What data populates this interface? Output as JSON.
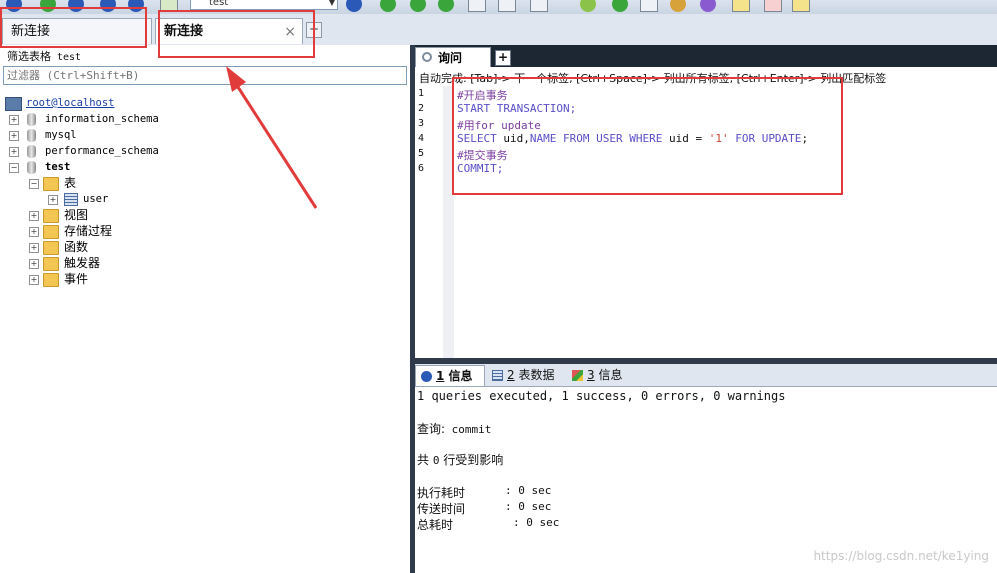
{
  "toolbar": {
    "database_select": "test",
    "colors": {
      "green": "#3aa53a",
      "blue": "#2b59b8"
    }
  },
  "connection_tabs": [
    {
      "label": "新连接"
    },
    {
      "label": "新连接",
      "close": "×"
    }
  ],
  "connection_add": "+",
  "left_panel": {
    "filter_caption": "筛选表格",
    "filter_db": "test",
    "filter_placeholder": "过滤器 (Ctrl+Shift+B)",
    "tree": {
      "root": "root@localhost",
      "databases": [
        "information_schema",
        "mysql",
        "performance_schema",
        "test"
      ],
      "test_children": {
        "tables_label": "表",
        "tables": [
          "user"
        ],
        "groups": [
          "视图",
          "存储过程",
          "函数",
          "触发器",
          "事件"
        ]
      }
    }
  },
  "query": {
    "tab_label": "询问",
    "add": "+",
    "hint": "自动完成: [Tab]-> 下一个标签, [Ctrl+Space]-> 列出所有标签, [Ctrl+Enter]-> 列出匹配标签",
    "line_numbers": [
      "1",
      "2",
      "3",
      "4",
      "5",
      "6"
    ],
    "code": {
      "l1": "#开启事务",
      "l2": "START TRANSACTION;",
      "l3": "#用for update",
      "l4_kw1": "SELECT",
      "l4_id1": " uid,",
      "l4_kw2": "NAME",
      "l4_kw3": " FROM USER WHERE",
      "l4_id2": " uid = ",
      "l4_str": "'1'",
      "l4_kw4": " FOR UPDATE",
      "l4_end": ";",
      "l5": "#提交事务",
      "l6": "COMMIT;"
    }
  },
  "results": {
    "tabs": [
      {
        "num": "1",
        "label": " 信息"
      },
      {
        "num": "2",
        "label": " 表数据"
      },
      {
        "num": "3",
        "label": " 信息"
      }
    ],
    "summary": "1 queries executed, 1 success, 0 errors, 0 warnings",
    "query_label": "查询:",
    "query_value": " commit",
    "affected_pre": "共 ",
    "affected_num": "0",
    "affected_post": " 行受到影响",
    "timings": [
      {
        "label": "执行耗时",
        "value": ": 0 sec"
      },
      {
        "label": "传送时间",
        "value": ": 0 sec"
      },
      {
        "label": "总耗时",
        "value": ": 0 sec"
      }
    ]
  },
  "watermark": "https://blog.csdn.net/ke1ying"
}
